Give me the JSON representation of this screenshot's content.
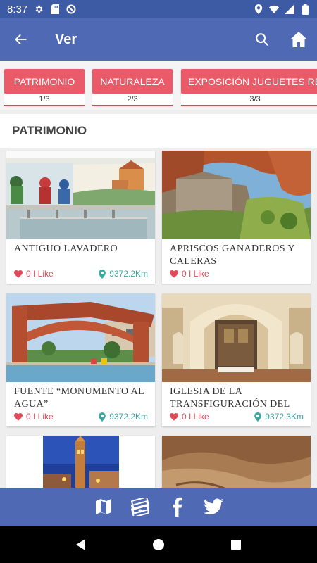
{
  "status_bar": {
    "time": "8:37"
  },
  "app_bar": {
    "title": "Ver"
  },
  "tabs": [
    {
      "label": "PATRIMONIO",
      "count": "1/3"
    },
    {
      "label": "NATURALEZA",
      "count": "2/3"
    },
    {
      "label": "EXPOSICIÓN JUGUETES RECO",
      "count": "3/3"
    }
  ],
  "section": {
    "title": "PATRIMONIO"
  },
  "cards": [
    {
      "name": "ANTIGUO LAVADERO",
      "likes": "0 I Like",
      "distance": "9372.2Km"
    },
    {
      "name": "APRISCOS GANADEROS Y CALERAS",
      "likes": "0 I Like",
      "distance": ""
    },
    {
      "name": "FUENTE “MONUMENTO AL AGUA”",
      "likes": "0 I Like",
      "distance": "9372.2Km"
    },
    {
      "name": "IGLESIA DE LA TRANSFIGURACIÓN DEL",
      "likes": "0 I Like",
      "distance": "9372.3Km"
    },
    {
      "name": "",
      "likes": "",
      "distance": ""
    },
    {
      "name": "",
      "likes": "",
      "distance": ""
    }
  ],
  "colors": {
    "status_bar": "#3d5aa5",
    "app_bar": "#4f69b5",
    "tab": "#eb5a68",
    "like": "#e04a5a",
    "distance": "#3ba8a0"
  }
}
